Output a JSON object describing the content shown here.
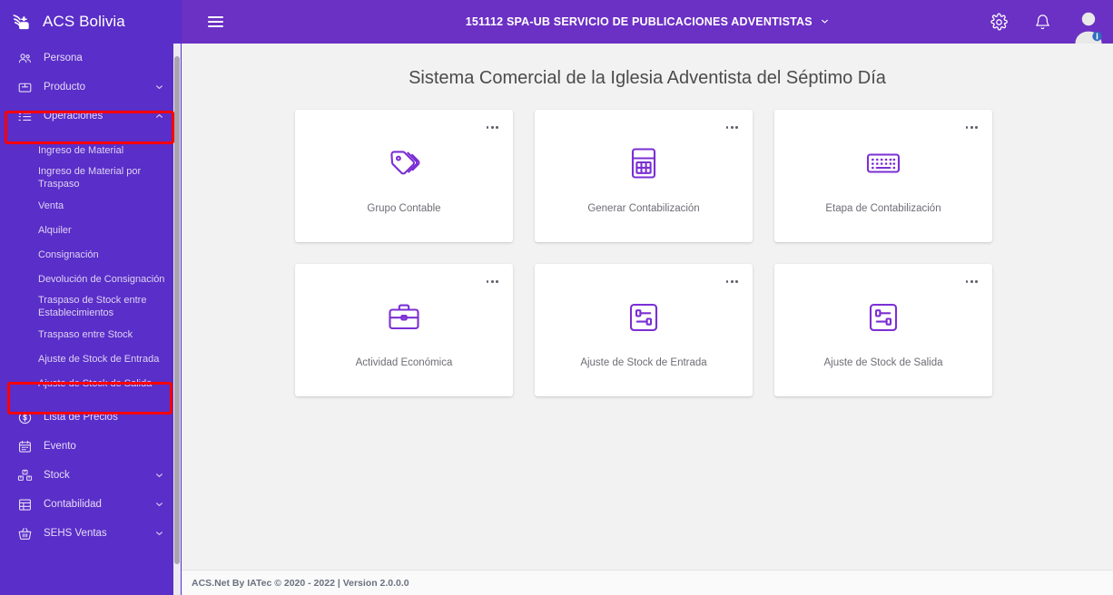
{
  "brand": {
    "name": "ACS Bolivia",
    "logo_icon": "acs-flame-logo"
  },
  "sidebar": {
    "items": [
      {
        "label": "Persona",
        "icon": "people-icon",
        "expandable": false
      },
      {
        "label": "Producto",
        "icon": "box-icon",
        "expandable": true,
        "caret": "chevron-down-icon"
      },
      {
        "label": "Operaciones",
        "icon": "checklist-icon",
        "expandable": true,
        "caret": "chevron-up-icon",
        "expanded": true,
        "highlighted": true
      }
    ],
    "operaciones_children": [
      {
        "label": "Ingreso de Material"
      },
      {
        "label": "Ingreso de Material por Traspaso"
      },
      {
        "label": "Venta"
      },
      {
        "label": "Alquiler"
      },
      {
        "label": "Consignación"
      },
      {
        "label": "Devolución de Consignación"
      },
      {
        "label": "Traspaso de Stock entre Establecimientos"
      },
      {
        "label": "Traspaso entre Stock"
      },
      {
        "label": "Ajuste de Stock de Entrada",
        "highlighted": true
      },
      {
        "label": "Ajuste de Stock de Salida"
      }
    ],
    "items_bottom": [
      {
        "label": "Lista de Precios",
        "icon": "dollar-circle-icon",
        "expandable": false
      },
      {
        "label": "Evento",
        "icon": "calendar-icon",
        "expandable": false
      },
      {
        "label": "Stock",
        "icon": "boxes-icon",
        "expandable": true,
        "caret": "chevron-down-icon"
      },
      {
        "label": "Contabilidad",
        "icon": "ledger-icon",
        "expandable": true,
        "caret": "chevron-down-icon"
      },
      {
        "label": "SEHS Ventas",
        "icon": "basket-icon",
        "expandable": true,
        "caret": "chevron-down-icon"
      }
    ]
  },
  "topbar": {
    "menu_toggle_icon": "hamburger-icon",
    "org_title": "151112 SPA-UB SERVICIO DE PUBLICACIONES ADVENTISTAS",
    "org_caret_icon": "chevron-down-icon",
    "settings_icon": "gear-icon",
    "notifications_icon": "bell-icon",
    "avatar_icon": "user-avatar-icon"
  },
  "main": {
    "page_title": "Sistema Comercial de la Iglesia Adventista del Séptimo Día",
    "cards": [
      {
        "label": "Grupo Contable",
        "icon": "tags-icon",
        "menu_icon": "more-options-icon"
      },
      {
        "label": "Generar Contabilización",
        "icon": "calculator-icon",
        "menu_icon": "more-options-icon"
      },
      {
        "label": "Etapa de Contabilización",
        "icon": "keyboard-icon",
        "menu_icon": "more-options-icon"
      },
      {
        "label": "Actividad Económica",
        "icon": "briefcase-icon",
        "menu_icon": "more-options-icon"
      },
      {
        "label": "Ajuste de Stock de Entrada",
        "icon": "sliders-square-icon",
        "menu_icon": "more-options-icon"
      },
      {
        "label": "Ajuste de Stock de Salida",
        "icon": "sliders-square-icon",
        "menu_icon": "more-options-icon"
      }
    ]
  },
  "footer": {
    "text": "ACS.Net By IATec © 2020 - 2022 | Version 2.0.0.0"
  },
  "colors": {
    "sidebar_purple": "#5a2ec8",
    "topbar_purple": "#6b30c4",
    "accent_icon_purple": "#7b2fd4",
    "highlight_red": "#ff0000",
    "content_bg": "#f2f2f2",
    "card_bg": "#ffffff"
  }
}
